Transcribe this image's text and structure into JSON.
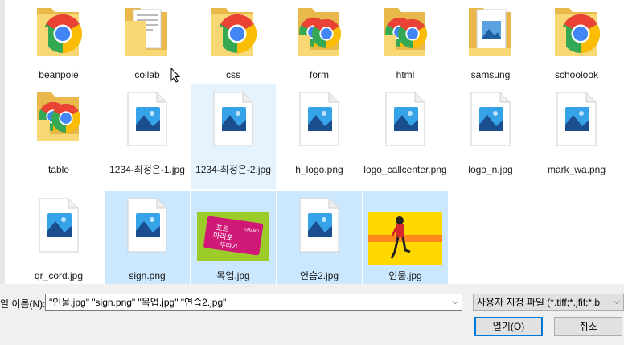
{
  "files": [
    {
      "name": "beanpole",
      "kind": "folder-chrome",
      "selected": false
    },
    {
      "name": "collab",
      "kind": "folder-docs",
      "selected": false
    },
    {
      "name": "css",
      "kind": "folder-chrome",
      "selected": false
    },
    {
      "name": "form",
      "kind": "folder-chrome2",
      "selected": false
    },
    {
      "name": "html",
      "kind": "folder-chrome2",
      "selected": false
    },
    {
      "name": "samsung",
      "kind": "folder-image",
      "selected": false
    },
    {
      "name": "schoolook",
      "kind": "folder-chrome",
      "selected": false
    },
    {
      "name": "table",
      "kind": "folder-chrome2",
      "selected": false
    },
    {
      "name": "1234-최정은-1.jpg",
      "kind": "image",
      "selected": false
    },
    {
      "name": "1234-최정은-2.jpg",
      "kind": "image",
      "selected": false,
      "hover": true
    },
    {
      "name": "h_logo.png",
      "kind": "image",
      "selected": false
    },
    {
      "name": "logo_callcenter.png",
      "kind": "image",
      "selected": false
    },
    {
      "name": "logo_n.jpg",
      "kind": "image",
      "selected": false
    },
    {
      "name": "mark_wa.png",
      "kind": "image",
      "selected": false
    },
    {
      "name": "qr_cord.jpg",
      "kind": "image",
      "selected": false
    },
    {
      "name": "sign.png",
      "kind": "image",
      "selected": true
    },
    {
      "name": "목업.jpg",
      "kind": "thumb-mockup",
      "selected": true
    },
    {
      "name": "연습2.jpg",
      "kind": "image",
      "selected": true
    },
    {
      "name": "인물.jpg",
      "kind": "thumb-person",
      "selected": true
    }
  ],
  "thumb_text": {
    "mockup_line1": "포르",
    "mockup_line2": "마리포",
    "mockup_line3": "뚜따기",
    "mockup_badge": "GRAND"
  },
  "bottom": {
    "filename_label": "일 이름(N):",
    "filename_value": "\"인물.jpg\" \"sign.png\" \"목업.jpg\" \"연습2.jpg\"",
    "filetype_value": "사용자 지정 파일 (*.tiff;*.jfif;*.b",
    "open_label": "열기(O)",
    "cancel_label": "취소"
  },
  "colors": {
    "selection": "#cce8ff",
    "hover": "#e5f3ff",
    "folder": "#f8d775",
    "accent": "#0078d7"
  }
}
